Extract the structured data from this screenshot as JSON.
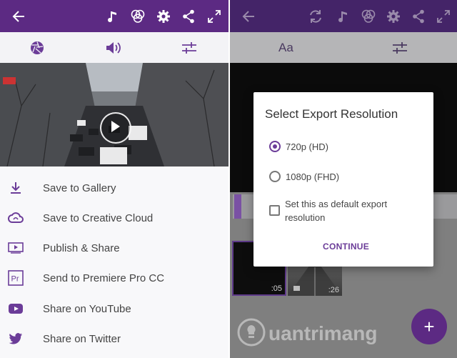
{
  "left_screen": {
    "menu_items": [
      {
        "label": "Save to Gallery",
        "icon": "download-icon"
      },
      {
        "label": "Save to Creative Cloud",
        "icon": "creative-cloud-icon"
      },
      {
        "label": "Publish & Share",
        "icon": "publish-share-icon"
      },
      {
        "label": "Send to Premiere Pro CC",
        "icon": "premiere-pro-icon",
        "icon_text": "Pr"
      },
      {
        "label": "Share on YouTube",
        "icon": "youtube-icon"
      },
      {
        "label": "Share on Twitter",
        "icon": "twitter-icon"
      }
    ]
  },
  "right_screen": {
    "subbar_text": "Aa",
    "thumb_times": [
      ":05",
      ":26"
    ],
    "fab_label": "+"
  },
  "dialog": {
    "title": "Select Export Resolution",
    "options": [
      {
        "label": "720p (HD)",
        "selected": true
      },
      {
        "label": "1080p (FHD)",
        "selected": false
      }
    ],
    "checkbox_line1": "Set this as default export",
    "checkbox_line2": "resolution",
    "checkbox_checked": false,
    "continue_label": "CONTINUE"
  },
  "watermark": {
    "text": "uantrimang"
  },
  "colors": {
    "primary_purple": "#5c2a83",
    "accent_purple": "#6b3c98",
    "dim_overlay": "#7a7a7a"
  }
}
